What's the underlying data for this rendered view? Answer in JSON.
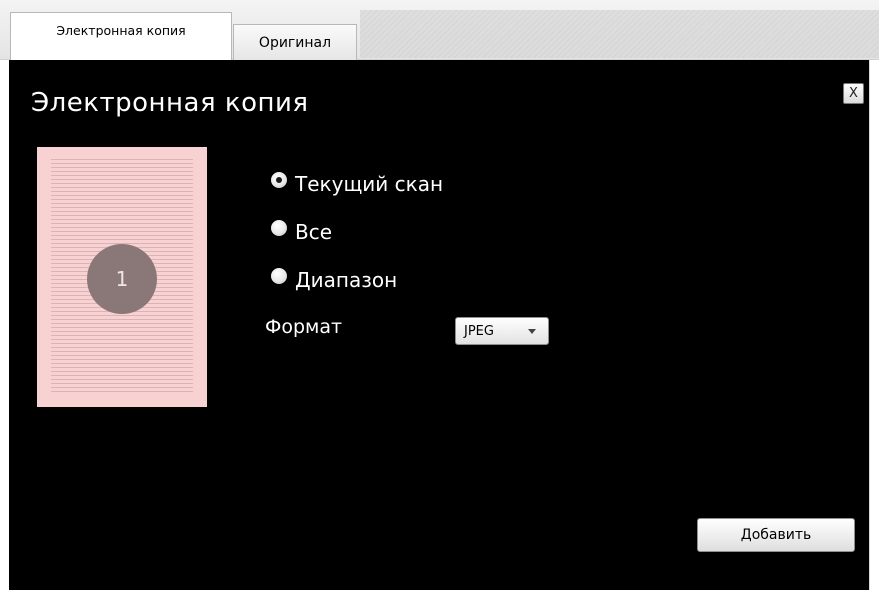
{
  "tabs": [
    {
      "label": "Электронная копия",
      "active": true
    },
    {
      "label": "Оригинал",
      "active": false
    }
  ],
  "panel": {
    "title": "Электронная копия",
    "close_label": "X"
  },
  "thumbnail": {
    "page_number": "1"
  },
  "scope_options": [
    {
      "label": "Текущий скан",
      "selected": true
    },
    {
      "label": "Все",
      "selected": false
    },
    {
      "label": "Диапазон",
      "selected": false
    }
  ],
  "format": {
    "label": "Формат",
    "selected": "JPEG"
  },
  "actions": {
    "add_label": "Добавить"
  },
  "colors": {
    "panel_background": "#000000",
    "thumbnail_background": "#f8d2d2",
    "badge": "#8a7878"
  },
  "icons": {
    "close": "close-icon",
    "dropdown": "chevron-down-icon"
  }
}
